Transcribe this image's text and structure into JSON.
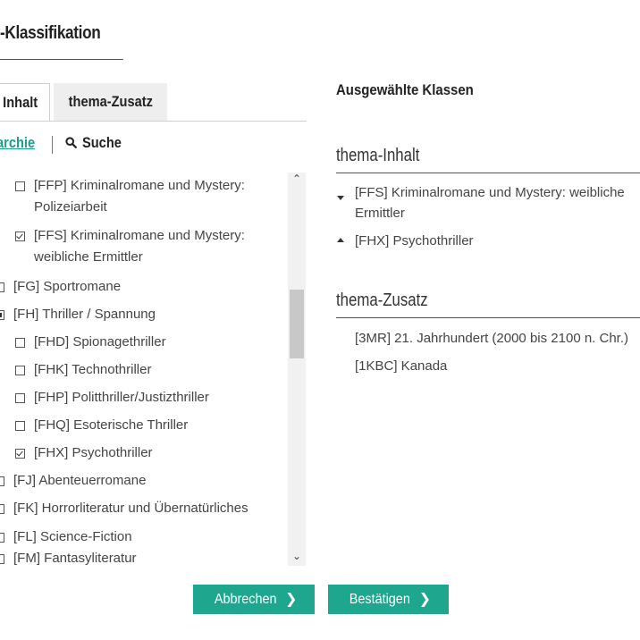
{
  "heading": "-Klassifikation",
  "tabs": {
    "active": "Inhalt",
    "inactive": "thema-Zusatz"
  },
  "modes": {
    "hierarchy": "archie",
    "search": "Suche"
  },
  "tree": [
    {
      "code_label": "[FFP] Kriminalromane und Mystery:",
      "line2": "Polizeiarbeit",
      "state": "unchecked",
      "level": 2
    },
    {
      "code_label": "[FFS] Kriminalromane und Mystery:",
      "line2": "weibliche Ermittler",
      "state": "checked",
      "level": 2
    },
    {
      "code_label": "[FG] Sportromane",
      "line2": "",
      "state": "unchecked",
      "level": 1
    },
    {
      "code_label": "[FH] Thriller / Spannung",
      "line2": "",
      "state": "partial",
      "level": 1
    },
    {
      "code_label": "[FHD] Spionagethriller",
      "line2": "",
      "state": "unchecked",
      "level": 2
    },
    {
      "code_label": "[FHK] Technothriller",
      "line2": "",
      "state": "unchecked",
      "level": 2
    },
    {
      "code_label": "[FHP] Politthriller/Justizthriller",
      "line2": "",
      "state": "unchecked",
      "level": 2
    },
    {
      "code_label": "[FHQ] Esoterische Thriller",
      "line2": "",
      "state": "unchecked",
      "level": 2
    },
    {
      "code_label": "[FHX] Psychothriller",
      "line2": "",
      "state": "checked",
      "level": 2
    },
    {
      "code_label": "[FJ] Abenteuerromane",
      "line2": "",
      "state": "unchecked",
      "level": 1
    },
    {
      "code_label": "[FK] Horrorliteratur und Übernatürliches",
      "line2": "",
      "state": "unchecked",
      "level": 1
    },
    {
      "code_label": "[FL] Science-Fiction",
      "line2": "",
      "state": "unchecked",
      "level": 1
    },
    {
      "code_label": "[FM] Fantasyliteratur",
      "line2": "",
      "state": "unchecked",
      "level": 1
    }
  ],
  "selected": {
    "title": "Ausgewählte Klassen",
    "inhalt": {
      "title": "thema-Inhalt",
      "items": [
        {
          "line1": "[FFS] Kriminalromane und Mystery: weibliche",
          "line2": "Ermittler",
          "arrow": "down"
        },
        {
          "line1": "[FHX] Psychothriller",
          "line2": "",
          "arrow": "up"
        }
      ]
    },
    "zusatz": {
      "title": "thema-Zusatz",
      "items": [
        {
          "line1": "[3MR] 21. Jahrhundert (2000 bis 2100 n. Chr.)"
        },
        {
          "line1": "[1KBC] Kanada"
        }
      ]
    }
  },
  "buttons": {
    "cancel": "Abbrechen",
    "confirm": "Bestätigen"
  }
}
